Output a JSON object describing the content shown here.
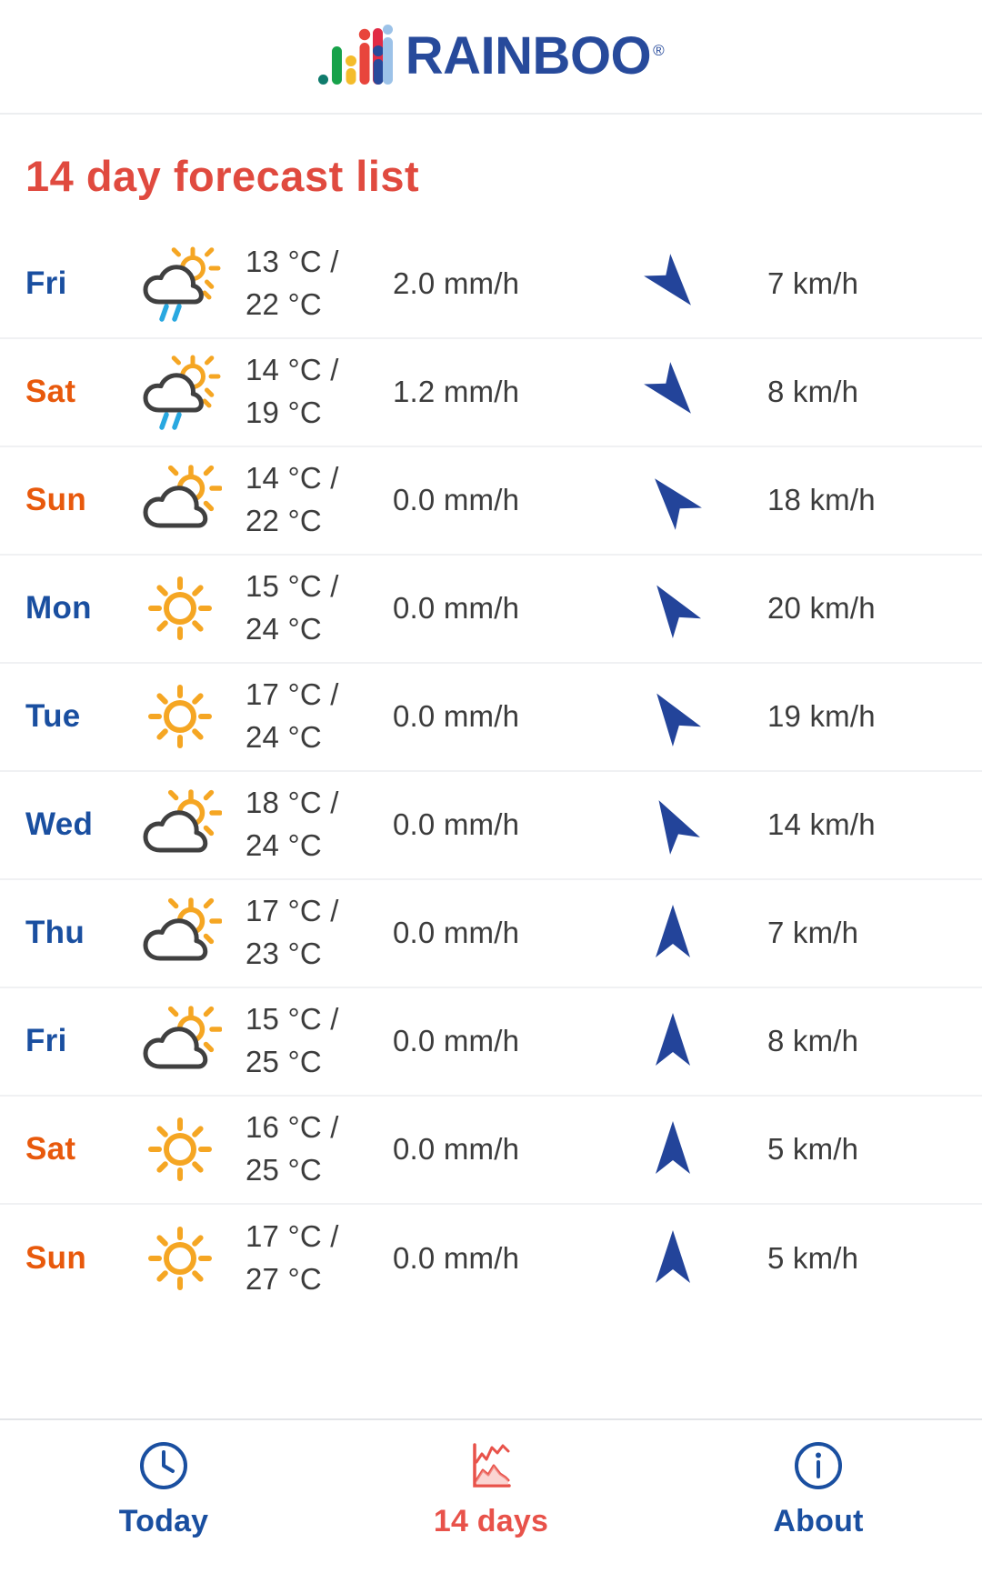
{
  "header": {
    "brand": "RAINBOO",
    "registered_mark": "®",
    "logo_icon": "rainboo-bar-logo"
  },
  "page": {
    "title": "14 day forecast list",
    "title_color": "#e04a3f"
  },
  "colors": {
    "weekday": "#1a4fa0",
    "weekend": "#e8590c",
    "text": "#3c3c3c",
    "accent_red": "#e8524a",
    "brand_navy": "#274a9b",
    "sun_orange": "#f5a623",
    "cloud_gray": "#404040",
    "rain_blue": "#29a8e0",
    "wind_blue": "#23449a"
  },
  "forecast": {
    "rows": [
      {
        "day": "Fri",
        "day_type": "weekday",
        "icon": "sun-cloud-rain-icon",
        "temp_min": "13 °C /",
        "temp_max": "22 °C",
        "precip": "2.0 mm/h",
        "wind_dir_deg": 140,
        "wind_icon": "wind-arrow-icon",
        "wind_speed": "7 km/h"
      },
      {
        "day": "Sat",
        "day_type": "weekend",
        "icon": "sun-cloud-rain-icon",
        "temp_min": "14 °C /",
        "temp_max": "19 °C",
        "precip": "1.2 mm/h",
        "wind_dir_deg": 140,
        "wind_icon": "wind-arrow-icon",
        "wind_speed": "8 km/h"
      },
      {
        "day": "Sun",
        "day_type": "weekend",
        "icon": "sun-cloud-icon",
        "temp_min": "14 °C /",
        "temp_max": "22 °C",
        "precip": "0.0 mm/h",
        "wind_dir_deg": 320,
        "wind_icon": "wind-arrow-icon",
        "wind_speed": "18 km/h"
      },
      {
        "day": "Mon",
        "day_type": "weekday",
        "icon": "sun-icon",
        "temp_min": "15 °C /",
        "temp_max": "24 °C",
        "precip": "0.0 mm/h",
        "wind_dir_deg": 325,
        "wind_icon": "wind-arrow-icon",
        "wind_speed": "20 km/h"
      },
      {
        "day": "Tue",
        "day_type": "weekday",
        "icon": "sun-icon",
        "temp_min": "17 °C /",
        "temp_max": "24 °C",
        "precip": "0.0 mm/h",
        "wind_dir_deg": 325,
        "wind_icon": "wind-arrow-icon",
        "wind_speed": "19 km/h"
      },
      {
        "day": "Wed",
        "day_type": "weekday",
        "icon": "sun-cloud-icon",
        "temp_min": "18 °C /",
        "temp_max": "24 °C",
        "precip": "0.0 mm/h",
        "wind_dir_deg": 330,
        "wind_icon": "wind-arrow-icon",
        "wind_speed": "14 km/h"
      },
      {
        "day": "Thu",
        "day_type": "weekday",
        "icon": "sun-cloud-icon",
        "temp_min": "17 °C /",
        "temp_max": "23 °C",
        "precip": "0.0 mm/h",
        "wind_dir_deg": 0,
        "wind_icon": "wind-arrow-icon",
        "wind_speed": "7 km/h"
      },
      {
        "day": "Fri",
        "day_type": "weekday",
        "icon": "sun-cloud-icon",
        "temp_min": "15 °C /",
        "temp_max": "25 °C",
        "precip": "0.0 mm/h",
        "wind_dir_deg": 0,
        "wind_icon": "wind-arrow-icon",
        "wind_speed": "8 km/h"
      },
      {
        "day": "Sat",
        "day_type": "weekend",
        "icon": "sun-icon",
        "temp_min": "16 °C /",
        "temp_max": "25 °C",
        "precip": "0.0 mm/h",
        "wind_dir_deg": 0,
        "wind_icon": "wind-arrow-icon",
        "wind_speed": "5 km/h"
      },
      {
        "day": "Sun",
        "day_type": "weekend",
        "icon": "sun-icon",
        "temp_min": "17 °C /",
        "temp_max": "27 °C",
        "precip": "0.0 mm/h",
        "wind_dir_deg": 0,
        "wind_icon": "wind-arrow-icon",
        "wind_speed": "5 km/h"
      }
    ]
  },
  "bottom_nav": {
    "items": [
      {
        "label": "Today",
        "icon": "clock-icon",
        "state": "inactive"
      },
      {
        "label": "14 days",
        "icon": "chart-icon",
        "state": "active"
      },
      {
        "label": "About",
        "icon": "info-icon",
        "state": "inactive"
      }
    ]
  }
}
